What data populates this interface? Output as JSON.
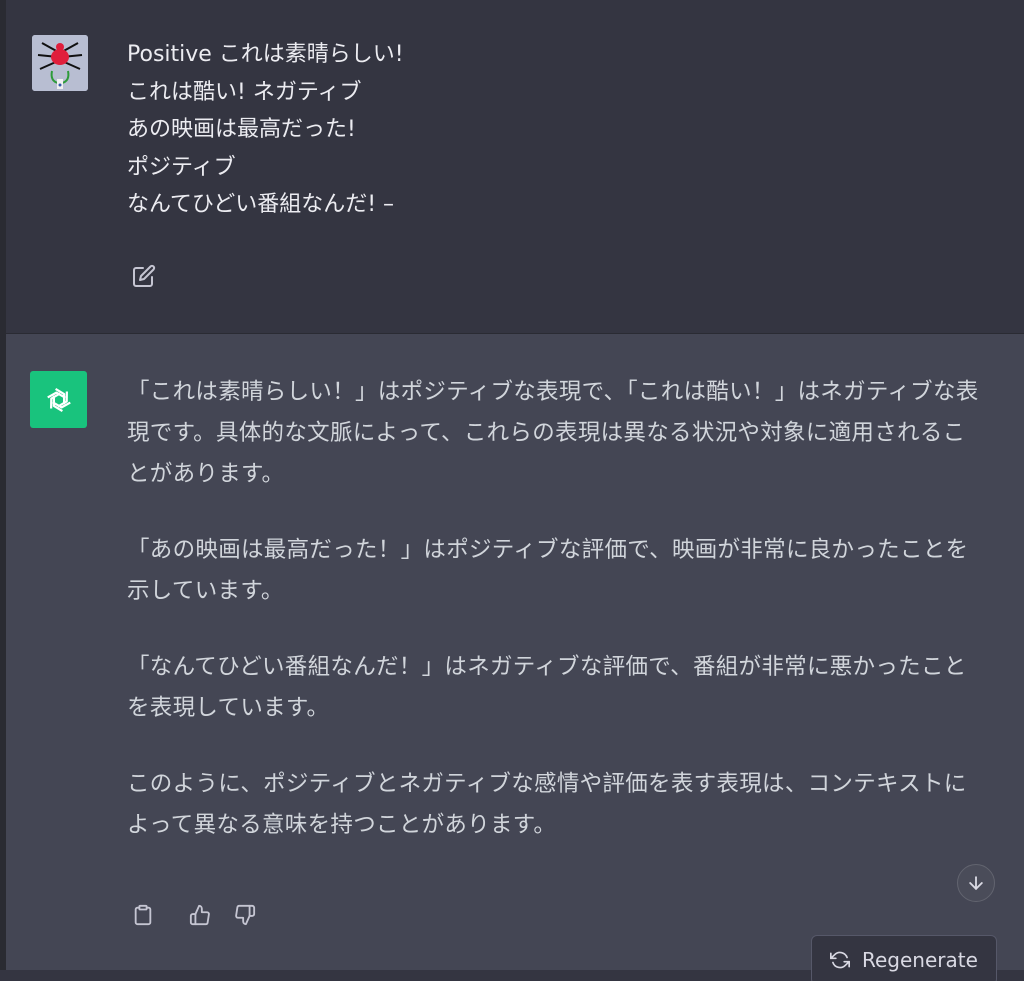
{
  "user_message": {
    "lines": [
      "Positive これは素晴らしい!",
      "これは酷い! ネガティブ",
      "あの映画は最高だった!",
      "ポジティブ",
      "なんてひどい番組なんだ! –"
    ],
    "avatar_icon": "spider-avatar-icon",
    "edit_icon": "edit-icon"
  },
  "assistant_message": {
    "avatar_icon": "openai-logo-icon",
    "paragraphs": [
      "「これは素晴らしい！」はポジティブな表現で、「これは酷い！」はネガティブな表現です。具体的な文脈によって、これらの表現は異なる状況や対象に適用されることがあります。",
      "「あの映画は最高だった！」はポジティブな評価で、映画が非常に良かったことを示しています。",
      "「なんてひどい番組なんだ！」はネガティブな評価で、番組が非常に悪かったことを表現しています。",
      "このように、ポジティブとネガティブな感情や評価を表す表現は、コンテキストによって異なる意味を持つことがあります。"
    ],
    "actions": [
      "clipboard-icon",
      "thumbs-up-icon",
      "thumbs-down-icon"
    ]
  },
  "controls": {
    "regenerate_label": "Regenerate",
    "scroll_down_icon": "arrow-down-icon"
  },
  "colors": {
    "user_bg": "#343541",
    "assistant_bg": "#444654",
    "gpt_green": "#19c37d"
  }
}
